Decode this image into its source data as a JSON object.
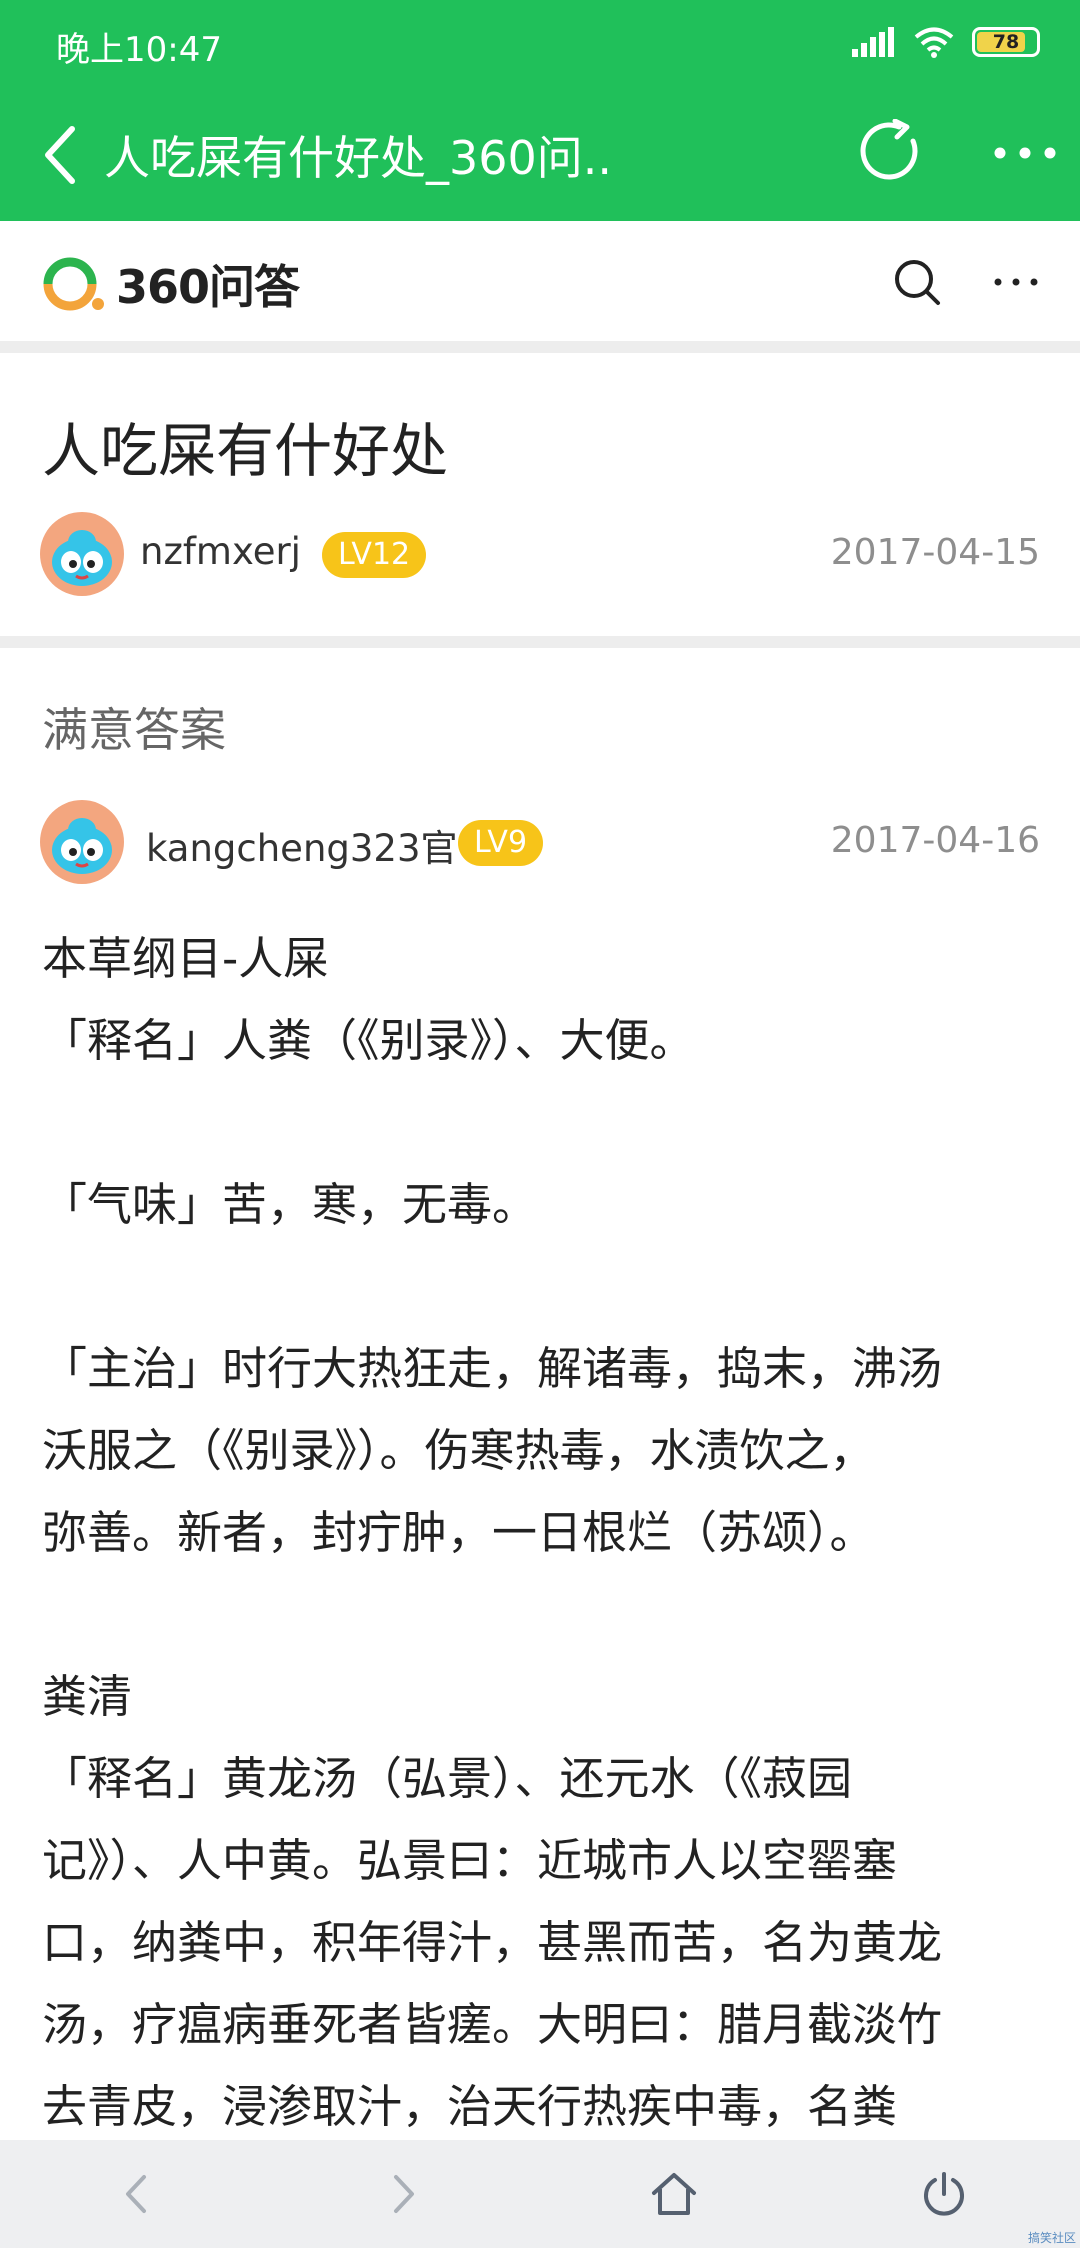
{
  "status_bar": {
    "time": "晚上10:47",
    "battery": "78"
  },
  "title_bar": {
    "title": "人吃屎有什好处_360问.."
  },
  "site": {
    "logo_text": "360问答"
  },
  "question": {
    "title": "人吃屎有什好处",
    "asker": {
      "name": "nzfmxerj",
      "level": "LV12",
      "date": "2017-04-15"
    }
  },
  "answer": {
    "heading": "满意答案",
    "author": {
      "name": "kangcheng323官",
      "level": "LV9",
      "date": "2017-04-16"
    },
    "lines": [
      "本草纲目-人屎",
      "「释名」人粪（《别录》）、大便。",
      "",
      "「气味」苦，寒，无毒。",
      "",
      "「主治」时行大热狂走，解诸毒，捣末，沸汤",
      "沃服之（《别录》）。伤寒热毒，水渍饮之，",
      "弥善。新者，封疔肿，一日根烂（苏颂）。",
      "",
      "粪清",
      "「释名」黄龙汤（弘景）、还元水（《菽园",
      "记》）、人中黄。弘景曰：近城市人以空罂塞",
      "口，纳粪中，积年得汁，甚黑而苦，名为黄龙",
      "汤，疗瘟病垂死者皆瘥。大明曰：腊月截淡竹",
      "去青皮，浸渗取汁，治天行热疾中毒，名粪"
    ]
  },
  "watermark": "搞笑社区"
}
